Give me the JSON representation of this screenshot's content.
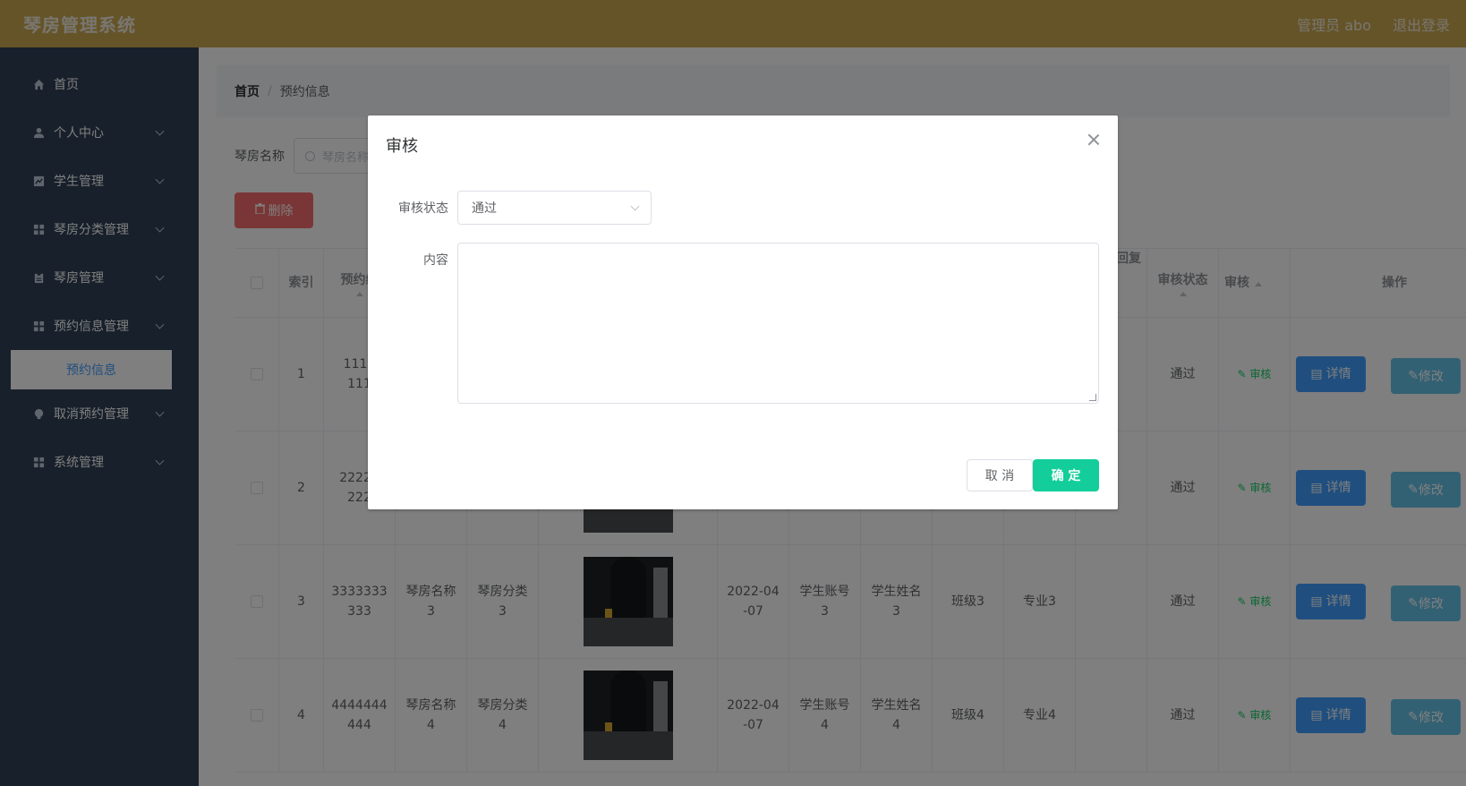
{
  "header": {
    "title": "琴房管理系统",
    "user": "管理员 abo",
    "logout": "退出登录"
  },
  "sidebar": {
    "items": [
      {
        "label": "首页",
        "icon": "home-icon",
        "has_children": false
      },
      {
        "label": "个人中心",
        "icon": "user-icon",
        "has_children": true
      },
      {
        "label": "学生管理",
        "icon": "chart-icon",
        "has_children": true
      },
      {
        "label": "琴房分类管理",
        "icon": "grid-icon",
        "has_children": true
      },
      {
        "label": "琴房管理",
        "icon": "clipboard-icon",
        "has_children": true
      },
      {
        "label": "预约信息管理",
        "icon": "grid-icon",
        "has_children": true
      },
      {
        "label": "取消预约管理",
        "icon": "bulb-icon",
        "has_children": true
      },
      {
        "label": "系统管理",
        "icon": "grid-icon",
        "has_children": true
      }
    ],
    "active_sub": "预约信息"
  },
  "breadcrumb": {
    "home": "首页",
    "separator": "/",
    "current": "预约信息"
  },
  "search": {
    "label": "琴房名称",
    "placeholder": "琴房名称"
  },
  "toolbar": {
    "delete_label": "删除"
  },
  "table": {
    "headers": {
      "index": "索引",
      "booking_no": "预约编",
      "reply": "回复",
      "audit_status": "审核状态",
      "audit": "审核",
      "actions": "操作"
    },
    "rows": [
      {
        "index": "1",
        "booking_no": "1111\n111",
        "status": "通过",
        "audit": "审核",
        "detail": "详情",
        "edit": "修改"
      },
      {
        "index": "2",
        "booking_no": "22222\n222",
        "status": "通过",
        "audit": "审核",
        "detail": "详情",
        "edit": "修改"
      },
      {
        "index": "3",
        "booking_no": "3333333\n333",
        "room_name": "琴房名称\n3",
        "room_category": "琴房分类\n3",
        "date": "2022-04\n-07",
        "account": "学生账号\n3",
        "student_name": "学生姓名\n3",
        "class": "班级3",
        "major": "专业3",
        "status": "通过",
        "audit": "审核",
        "detail": "详情",
        "edit": "修改"
      },
      {
        "index": "4",
        "booking_no": "4444444\n444",
        "room_name": "琴房名称\n4",
        "room_category": "琴房分类\n4",
        "date": "2022-04\n-07",
        "account": "学生账号\n4",
        "student_name": "学生姓名\n4",
        "class": "班级4",
        "major": "专业4",
        "status": "通过",
        "audit": "审核",
        "detail": "详情",
        "edit": "修改"
      }
    ]
  },
  "dialog": {
    "title": "审核",
    "status_label": "审核状态",
    "status_value": "通过",
    "content_label": "内容",
    "content_value": "",
    "cancel_label": "取 消",
    "confirm_label": "确 定"
  },
  "colors": {
    "header_bg": "#cba950",
    "sidebar_bg": "#304156",
    "confirm": "#13ce9a",
    "delete": "#f56c6c",
    "detail": "#409eff"
  }
}
